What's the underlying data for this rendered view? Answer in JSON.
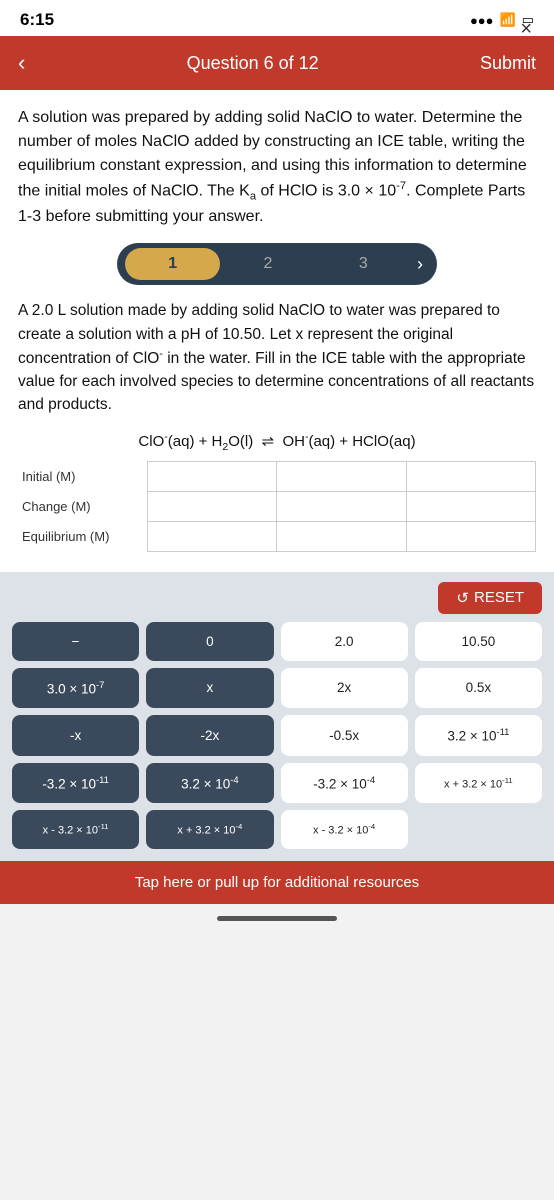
{
  "close": "×",
  "status": {
    "time": "6:15",
    "signal": "●●●",
    "wifi": "WiFi",
    "battery": "🔋"
  },
  "header": {
    "back_label": "‹",
    "title": "Question 6 of 12",
    "submit_label": "Submit"
  },
  "question": {
    "main_text": "A solution was prepared by adding solid NaClO to water. Determine the number of moles NaClO added by constructing an ICE table, writing the equilibrium constant expression, and using this information to determine the initial moles of NaClO. The Ka of HClO is 3.0 × 10⁻⁷. Complete Parts 1-3 before submitting your answer.",
    "steps": [
      "1",
      "2",
      "3"
    ],
    "active_step": 0,
    "sub_text": "A 2.0 L solution made by adding solid NaClO to water was prepared to create a solution with a pH of 10.50. Let x represent the original concentration of ClO⁻ in the water. Fill in the ICE table with the appropriate value for each involved species to determine concentrations of all reactants and products.",
    "equation": "ClO⁻(aq) + H₂O(l) ⇌ OH⁻(aq) + HClO(aq)"
  },
  "ice_table": {
    "rows": [
      "Initial (M)",
      "Change (M)",
      "Equilibrium (M)"
    ],
    "cols": 4
  },
  "calculator": {
    "reset_label": "RESET",
    "buttons": [
      [
        "−",
        "0",
        "2.0",
        "10.50"
      ],
      [
        "3.0 × 10⁻⁷",
        "x",
        "2x",
        "0.5x"
      ],
      [
        "-x",
        "-2x",
        "-0.5x",
        "3.2 × 10⁻¹¹"
      ],
      [
        "-3.2 × 10⁻¹¹",
        "3.2 × 10⁻⁴",
        "-3.2 × 10⁻⁴",
        "x + 3.2 × 10⁻¹¹"
      ],
      [
        "x - 3.2 × 10⁻¹¹",
        "x + 3.2 × 10⁻⁴",
        "x - 3.2 × 10⁻⁴",
        ""
      ]
    ]
  },
  "resources_bar": {
    "label": "Tap here or pull up for additional resources"
  }
}
